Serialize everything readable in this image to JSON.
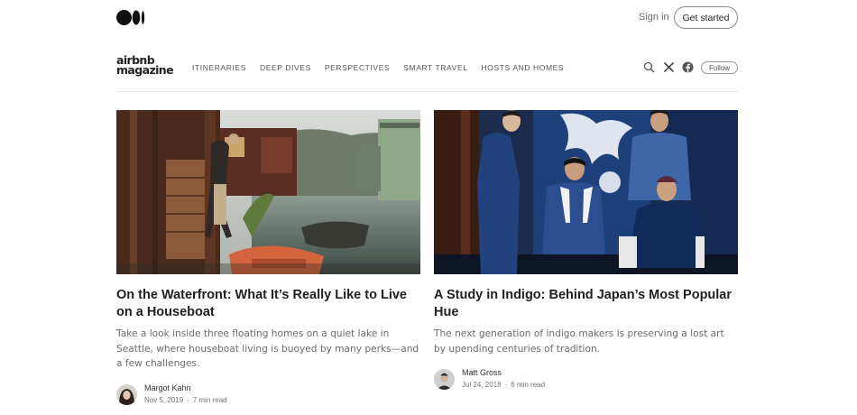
{
  "topbar": {
    "signin_label": "Sign in",
    "get_started_label": "Get started"
  },
  "publication": {
    "logo_line1": "airbnb",
    "logo_line2": "magazine",
    "nav": [
      "ITINERARIES",
      "DEEP DIVES",
      "PERSPECTIVES",
      "SMART TRAVEL",
      "HOSTS AND HOMES"
    ],
    "follow_label": "Follow",
    "icons": [
      "search-icon",
      "x-icon",
      "facebook-icon"
    ]
  },
  "articles": [
    {
      "title": "On the Waterfront: What It’s Really Like to Live on a Houseboat",
      "subtitle": "Take a look inside three floating homes on a quiet lake in Seattle, where houseboat living is buoyed by many perks—and a few challenges.",
      "author": "Margot Kahn",
      "date": "Nov 5, 2019",
      "read_time": "7 min read"
    },
    {
      "title": "A Study in Indigo: Behind Japan’s Most Popular Hue",
      "subtitle": "The next generation of indigo makers is preserving a lost art by upending centuries of tradition.",
      "author": "Matt Gross",
      "date": "Jul 24, 2018",
      "read_time": "6 min read"
    }
  ],
  "meta_separator": "·",
  "colors": {
    "text": "#292929",
    "muted": "#6b6b6b",
    "indigo": "#1c3a6e"
  }
}
